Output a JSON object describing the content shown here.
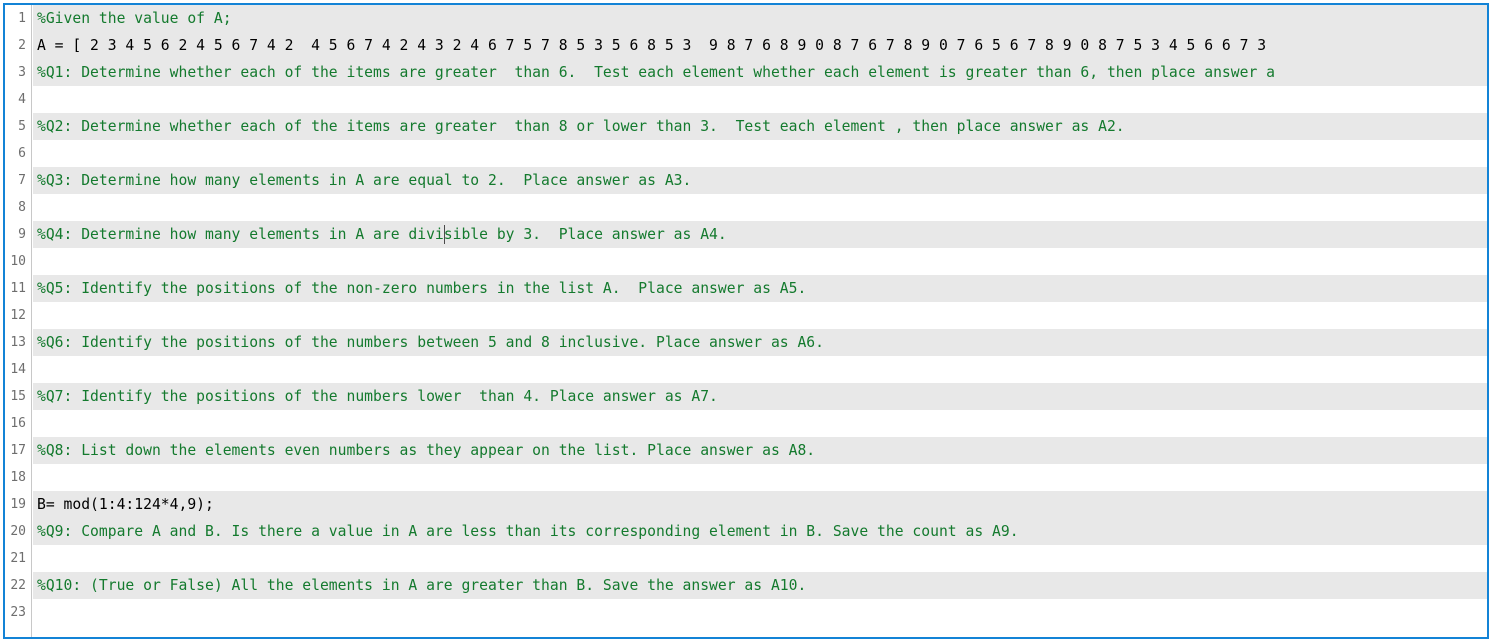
{
  "window": {
    "type": "matlab-script-editor",
    "focus_border_color": "#1383d6",
    "background_color": "#ffffff",
    "line_highlight_color": "#e8e8e8",
    "comment_color": "#147a2e",
    "code_color": "#000000",
    "gutter_text_color": "#6e6e6e"
  },
  "gutter": {
    "line_numbers": [
      "1",
      "2",
      "3",
      "4",
      "5",
      "6",
      "7",
      "8",
      "9",
      "10",
      "11",
      "12",
      "13",
      "14",
      "15",
      "16",
      "17",
      "18",
      "19",
      "20",
      "21",
      "22",
      "23"
    ]
  },
  "caret": {
    "visible": true,
    "line": 9,
    "after_text": "%Q4: Determine how many elements in A a"
  },
  "editor": {
    "lines": [
      {
        "number": "1",
        "text": "%Given the value of A;",
        "kind": "comment",
        "filled": true
      },
      {
        "number": "2",
        "text": "A = [ 2 3 4 5 6 2 4 5 6 7 4 2  4 5 6 7 4 2 4 3 2 4 6 7 5 7 8 5 3 5 6 8 5 3  9 8 7 6 8 9 0 8 7 6 7 8 9 0 7 6 5 6 7 8 9 0 8 7 5 3 4 5 6 6 7 3",
        "kind": "code",
        "filled": true,
        "truncated": true
      },
      {
        "number": "3",
        "text": "%Q1: Determine whether each of the items are greater  than 6.  Test each element whether each element is greater than 6, then place answer a",
        "kind": "comment",
        "filled": true,
        "truncated": true
      },
      {
        "number": "4",
        "text": "",
        "kind": "blank",
        "filled": false
      },
      {
        "number": "5",
        "text": "%Q2: Determine whether each of the items are greater  than 8 or lower than 3.  Test each element , then place answer as A2.",
        "kind": "comment",
        "filled": true
      },
      {
        "number": "6",
        "text": "",
        "kind": "blank",
        "filled": false
      },
      {
        "number": "7",
        "text": "%Q3: Determine how many elements in A are equal to 2.  Place answer as A3.",
        "kind": "comment",
        "filled": true
      },
      {
        "number": "8",
        "text": "",
        "kind": "blank",
        "filled": false
      },
      {
        "number": "9",
        "text": "%Q4: Determine how many elements in A are divisible by 3.  Place answer as A4.",
        "kind": "comment",
        "filled": true
      },
      {
        "number": "10",
        "text": "",
        "kind": "blank",
        "filled": false
      },
      {
        "number": "11",
        "text": "%Q5: Identify the positions of the non-zero numbers in the list A.  Place answer as A5.",
        "kind": "comment",
        "filled": true
      },
      {
        "number": "12",
        "text": "",
        "kind": "blank",
        "filled": false
      },
      {
        "number": "13",
        "text": "%Q6: Identify the positions of the numbers between 5 and 8 inclusive. Place answer as A6.",
        "kind": "comment",
        "filled": true
      },
      {
        "number": "14",
        "text": "",
        "kind": "blank",
        "filled": false
      },
      {
        "number": "15",
        "text": "%Q7: Identify the positions of the numbers lower  than 4. Place answer as A7.",
        "kind": "comment",
        "filled": true
      },
      {
        "number": "16",
        "text": "",
        "kind": "blank",
        "filled": false
      },
      {
        "number": "17",
        "text": "%Q8: List down the elements even numbers as they appear on the list. Place answer as A8.",
        "kind": "comment",
        "filled": true
      },
      {
        "number": "18",
        "text": "",
        "kind": "blank",
        "filled": false
      },
      {
        "number": "19",
        "text": "B= mod(1:4:124*4,9);",
        "kind": "code",
        "filled": true
      },
      {
        "number": "20",
        "text": "%Q9: Compare A and B. Is there a value in A are less than its corresponding element in B. Save the count as A9.",
        "kind": "comment",
        "filled": true
      },
      {
        "number": "21",
        "text": "",
        "kind": "blank",
        "filled": false
      },
      {
        "number": "22",
        "text": "%Q10: (True or False) All the elements in A are greater than B. Save the answer as A10.",
        "kind": "comment",
        "filled": true
      },
      {
        "number": "23",
        "text": "",
        "kind": "blank",
        "filled": false
      }
    ]
  }
}
